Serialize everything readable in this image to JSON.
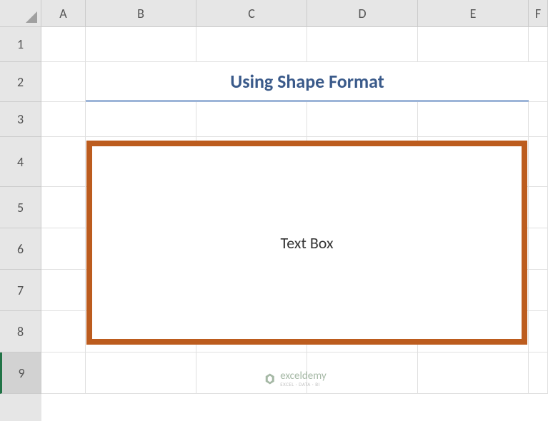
{
  "columns": [
    "A",
    "B",
    "C",
    "D",
    "E",
    "F"
  ],
  "rows": [
    "1",
    "2",
    "3",
    "4",
    "5",
    "6",
    "7",
    "8",
    "9"
  ],
  "activeRow": 9,
  "title": "Using Shape Format",
  "textbox": {
    "content": "Text Box",
    "border_color": "#bc5c1e"
  },
  "watermark": {
    "name": "exceldemy",
    "subtitle": "EXCEL · DATA · BI"
  }
}
